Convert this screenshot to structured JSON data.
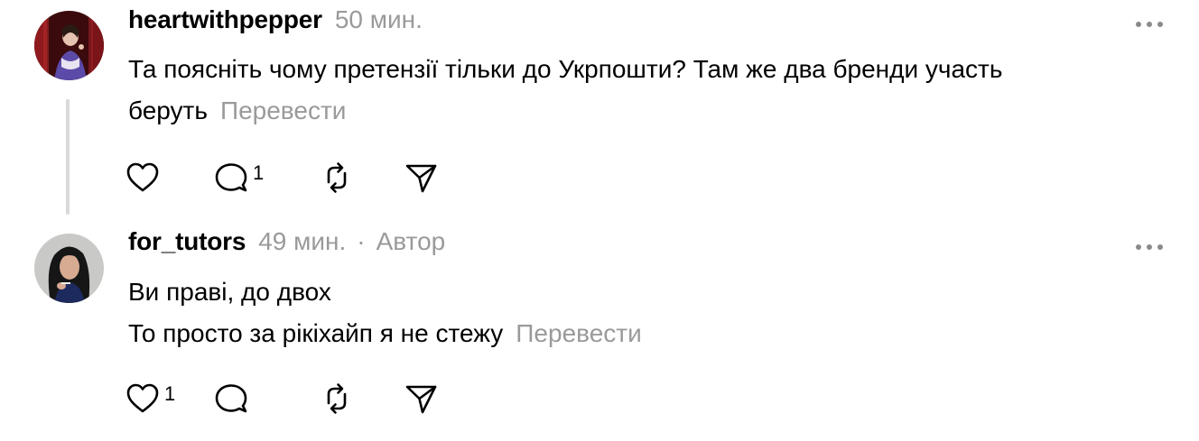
{
  "posts": [
    {
      "username": "heartwithpepper",
      "time": "50 мин.",
      "author_badge": "",
      "lines": [
        "Та поясніть чому претензії тільки до Укрпошти? Там же два бренди участь",
        "беруть"
      ],
      "translate_label": "Перевести",
      "like_count": "",
      "reply_count": "1",
      "icons": [
        "heart-icon",
        "comment-icon",
        "repost-icon",
        "share-icon",
        "more-icon"
      ]
    },
    {
      "username": "for_tutors",
      "time": "49 мин.",
      "dot": "·",
      "author_badge": "Автор",
      "lines": [
        "Ви праві, до двох",
        "То просто за рікіхайп я не стежу"
      ],
      "translate_label": "Перевести",
      "like_count": "1",
      "reply_count": "",
      "icons": [
        "heart-icon",
        "comment-icon",
        "repost-icon",
        "share-icon",
        "more-icon"
      ]
    }
  ],
  "colors": {
    "text": "#000000",
    "muted": "#9a9a9a",
    "thread_line": "#d9d9d9",
    "background": "#ffffff"
  }
}
